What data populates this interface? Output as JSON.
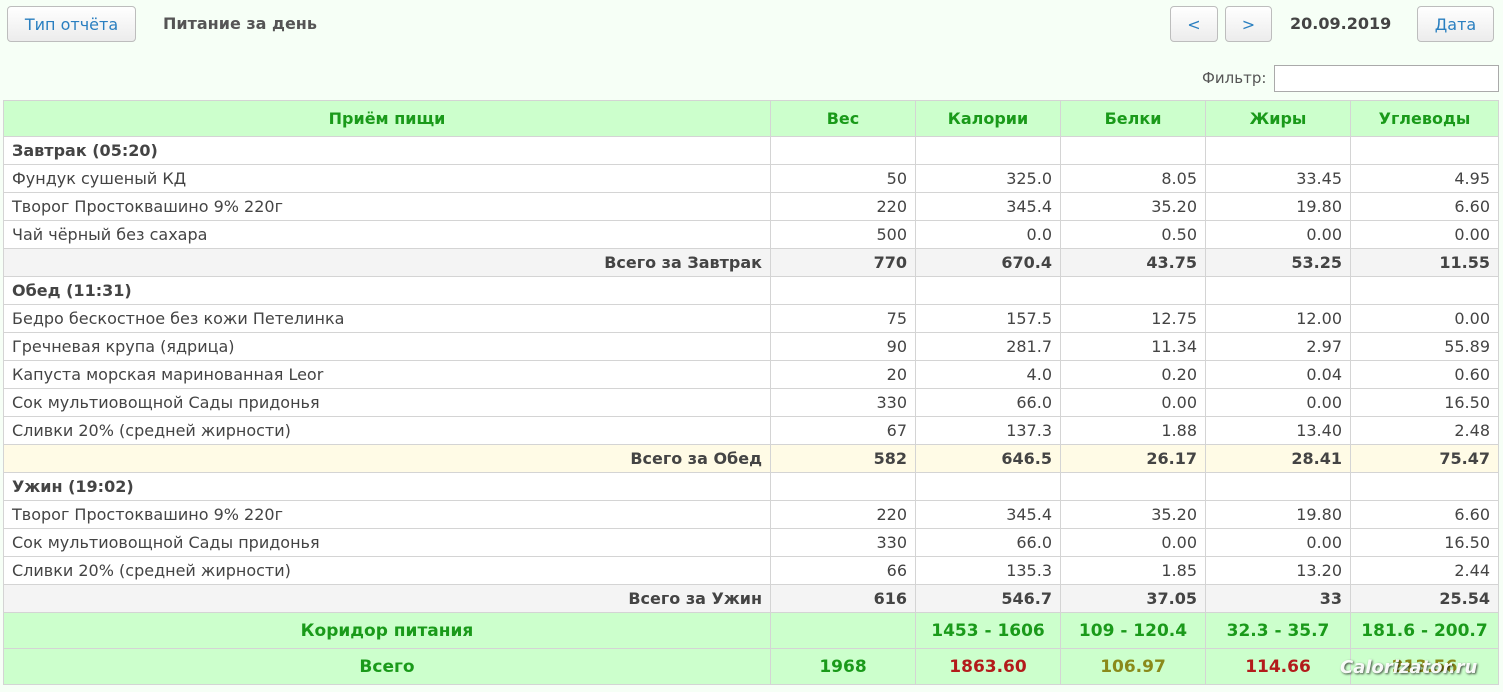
{
  "header": {
    "report_type_label": "Тип отчёта",
    "title": "Питание за день",
    "prev_label": "<",
    "next_label": ">",
    "date": "20.09.2019",
    "date_button_label": "Дата"
  },
  "filter": {
    "label": "Фильтр:",
    "value": "",
    "placeholder": ""
  },
  "columns": [
    "Приём пищи",
    "Вес",
    "Калории",
    "Белки",
    "Жиры",
    "Углеводы"
  ],
  "meals": [
    {
      "name": "Завтрак (05:20)",
      "items": [
        [
          "Фундук сушеный КД",
          "50",
          "325.0",
          "8.05",
          "33.45",
          "4.95"
        ],
        [
          "Творог Простоквашино 9% 220г",
          "220",
          "345.4",
          "35.20",
          "19.80",
          "6.60"
        ],
        [
          "Чай чёрный без сахара",
          "500",
          "0.0",
          "0.50",
          "0.00",
          "0.00"
        ]
      ],
      "total": [
        "Всего за Завтрак",
        "770",
        "670.4",
        "43.75",
        "53.25",
        "11.55"
      ]
    },
    {
      "name": "Обед (11:31)",
      "items": [
        [
          "Бедро бескостное без кожи Петелинка",
          "75",
          "157.5",
          "12.75",
          "12.00",
          "0.00"
        ],
        [
          "Гречневая крупа (ядрица)",
          "90",
          "281.7",
          "11.34",
          "2.97",
          "55.89"
        ],
        [
          "Капуста морская маринованная Leor",
          "20",
          "4.0",
          "0.20",
          "0.04",
          "0.60"
        ],
        [
          "Сок мультиовощной Сады придонья",
          "330",
          "66.0",
          "0.00",
          "0.00",
          "16.50"
        ],
        [
          "Сливки 20% (средней жирности)",
          "67",
          "137.3",
          "1.88",
          "13.40",
          "2.48"
        ]
      ],
      "total": [
        "Всего за Обед",
        "582",
        "646.5",
        "26.17",
        "28.41",
        "75.47"
      ]
    },
    {
      "name": "Ужин (19:02)",
      "items": [
        [
          "Творог Простоквашино 9% 220г",
          "220",
          "345.4",
          "35.20",
          "19.80",
          "6.60"
        ],
        [
          "Сок мультиовощной Сады придонья",
          "330",
          "66.0",
          "0.00",
          "0.00",
          "16.50"
        ],
        [
          "Сливки 20% (средней жирности)",
          "66",
          "135.3",
          "1.85",
          "13.20",
          "2.44"
        ]
      ],
      "total": [
        "Всего за Ужин",
        "616",
        "546.7",
        "37.05",
        "33",
        "25.54"
      ]
    }
  ],
  "corridor": [
    "Коридор питания",
    "",
    "1453 - 1606",
    "109 - 120.4",
    "32.3 - 35.7",
    "181.6 - 200.7"
  ],
  "grand_total": [
    "Всего",
    "1968",
    "1863.60",
    "106.97",
    "114.66",
    "213.56"
  ],
  "grand_total_status": [
    "",
    "",
    "red",
    "olive",
    "red",
    "olive"
  ],
  "watermark": "Calorizator.ru"
}
